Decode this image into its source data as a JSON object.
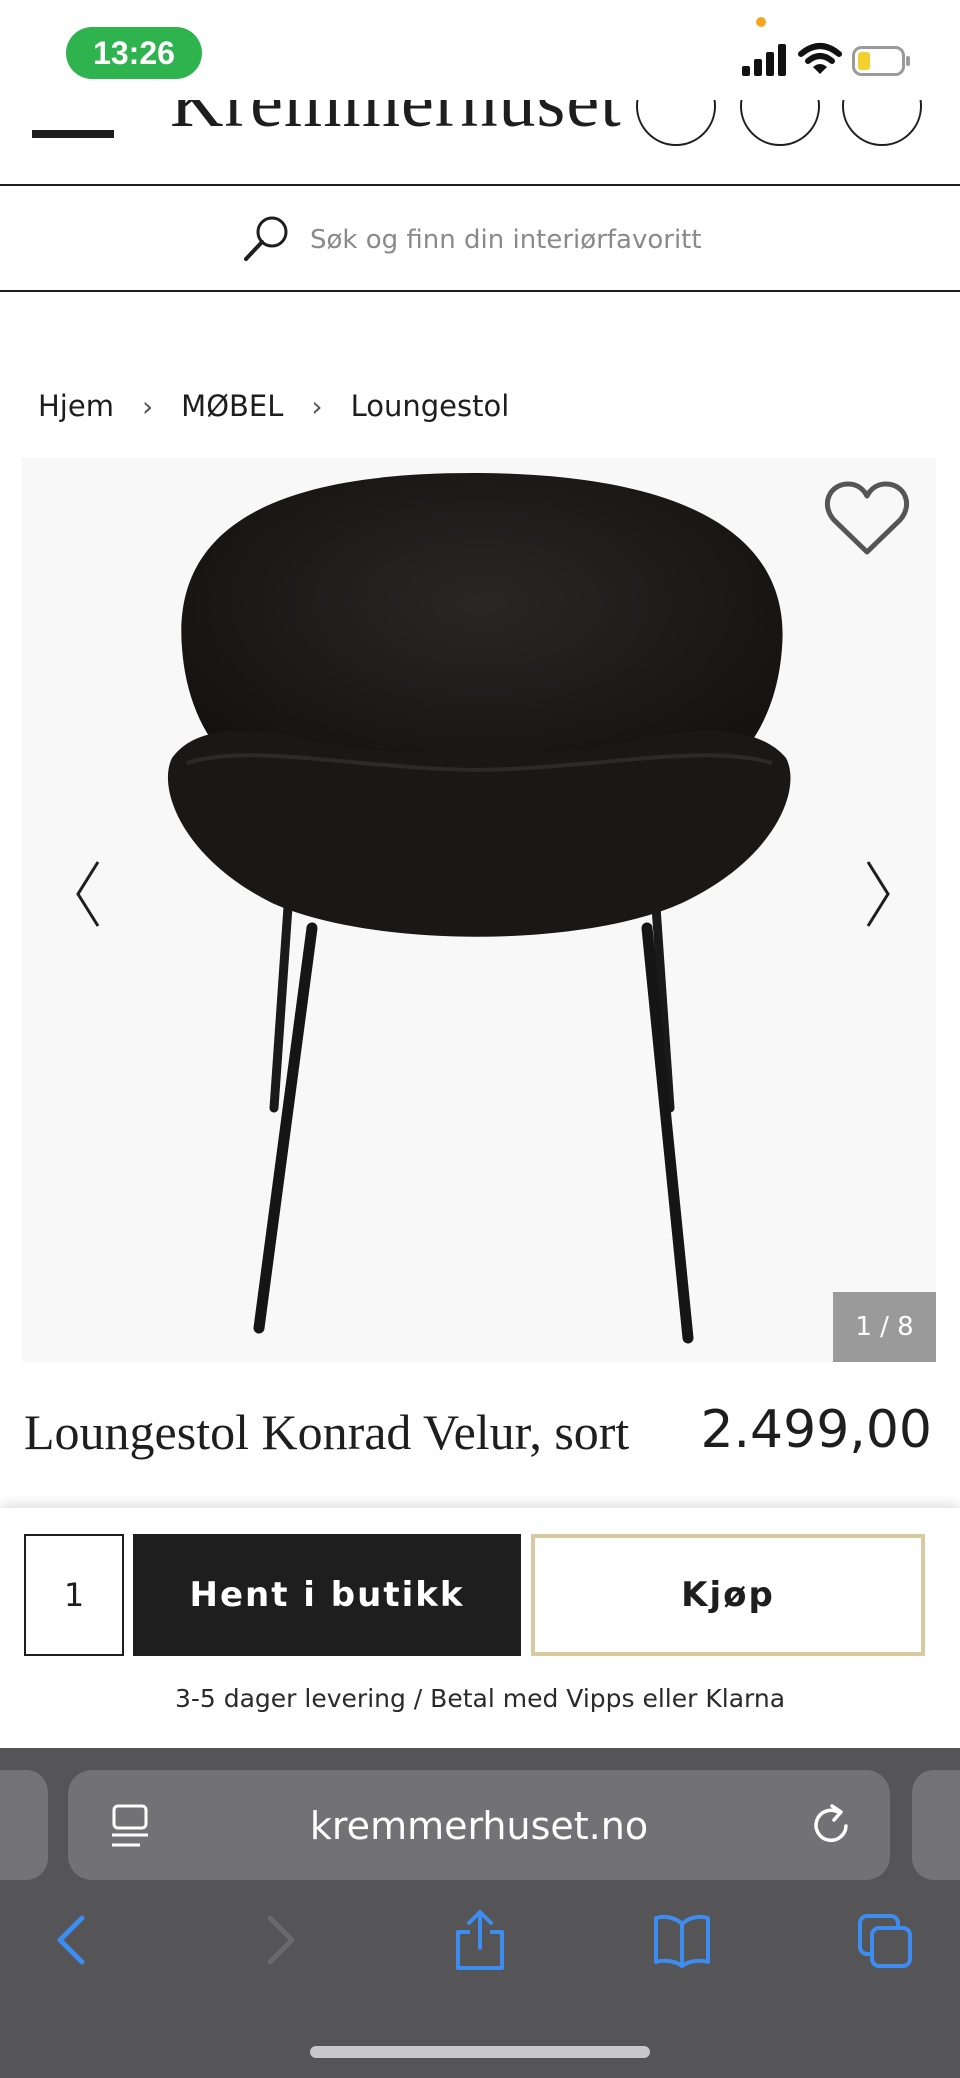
{
  "status_bar": {
    "time": "13:26"
  },
  "header": {
    "logo": "Kremmerhuset",
    "icons": [
      "menu-icon",
      "heart-circle-icon",
      "user-circle-icon",
      "cart-icon"
    ]
  },
  "search": {
    "placeholder": "Søk og finn din interiørfavoritt"
  },
  "breadcrumb": {
    "items": [
      "Hjem",
      "MØBEL",
      "Loungestol"
    ],
    "separator": "›"
  },
  "gallery": {
    "counter": "1 / 8",
    "current_image": 1,
    "total_images": 8
  },
  "product": {
    "title": "Loungestol Konrad Velur, sort",
    "price": "2.499,00"
  },
  "buy_bar": {
    "quantity": "1",
    "store_button": "Hent i butikk",
    "buy_button": "Kjøp",
    "delivery_text": "3-5 dager levering / Betal med Vipps eller Klarna"
  },
  "browser": {
    "url": "kremmerhuset.no"
  },
  "colors": {
    "status_pill": "#2fb34e",
    "text_dark": "#1e1e1e",
    "buy_border": "#d8c9a3",
    "safari_blue": "#3d8cf0",
    "safari_bg": "#555557"
  }
}
